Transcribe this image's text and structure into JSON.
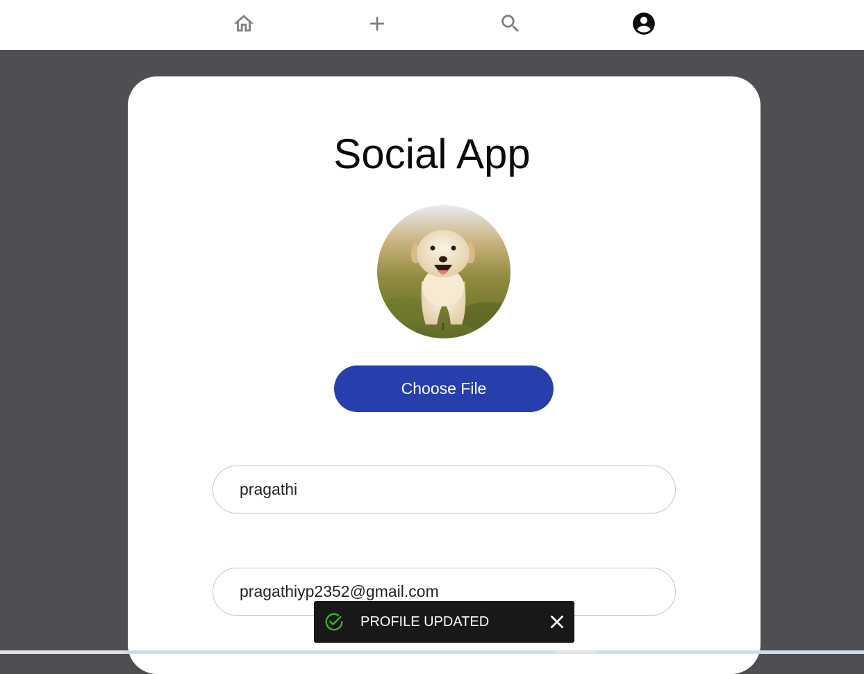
{
  "nav": {
    "items": [
      {
        "icon": "home-icon"
      },
      {
        "icon": "plus-icon"
      },
      {
        "icon": "search-icon"
      },
      {
        "icon": "account-circle-icon",
        "active": true
      }
    ]
  },
  "card": {
    "title": "Social App",
    "choose_file_label": "Choose File",
    "name_value": "pragathi",
    "email_value": "pragathiyp2352@gmail.com"
  },
  "toast": {
    "message": "PROFILE UPDATED",
    "icon": "check-circle-icon",
    "close_icon": "close-icon"
  },
  "colors": {
    "background": "#4f4e53",
    "card": "#ffffff",
    "accent_button": "#263fad",
    "toast_bg": "#181818",
    "success_icon": "#34c21d"
  }
}
